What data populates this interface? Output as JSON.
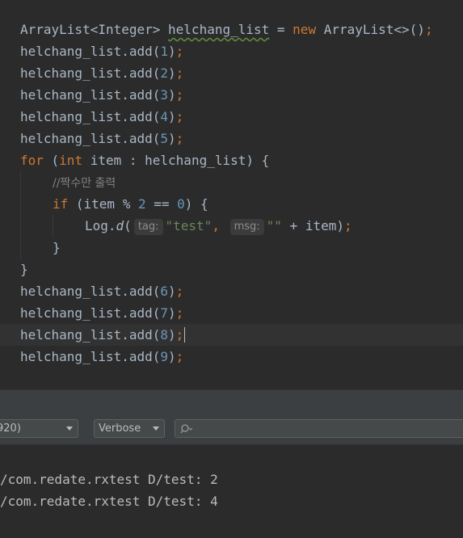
{
  "editor": {
    "line1": {
      "type": "ArrayList<Integer> ",
      "var": "helchang_list",
      "eq": " = ",
      "kw_new": "new",
      "ctor": " ArrayList<>()",
      "semi": ";"
    },
    "adds_top": [
      {
        "prefix": "helchang_list.add(",
        "num": "1",
        "suffix": ")",
        "semi": ";"
      },
      {
        "prefix": "helchang_list.add(",
        "num": "2",
        "suffix": ")",
        "semi": ";"
      },
      {
        "prefix": "helchang_list.add(",
        "num": "3",
        "suffix": ")",
        "semi": ";"
      },
      {
        "prefix": "helchang_list.add(",
        "num": "4",
        "suffix": ")",
        "semi": ";"
      },
      {
        "prefix": "helchang_list.add(",
        "num": "5",
        "suffix": ")",
        "semi": ";"
      }
    ],
    "for_line": {
      "kw_for": "for",
      "open": " (",
      "kw_int": "int",
      "rest": " item : helchang_list) {"
    },
    "comment": "//짝수만 출력",
    "if_line": {
      "kw_if": "if",
      "open": " (item % ",
      "num2": "2",
      "mid": " == ",
      "num0": "0",
      "close": ") {"
    },
    "log_line": {
      "obj": "Log.",
      "method": "d",
      "paren": "(",
      "hint_tag": "tag:",
      "str_test": "\"test\"",
      "comma": ",",
      "hint_msg": "msg:",
      "str_empty": "\"\"",
      "rest": " + item)",
      "semi": ";"
    },
    "close_if": "}",
    "close_for": "}",
    "adds_bottom": [
      {
        "prefix": "helchang_list.add(",
        "num": "6",
        "suffix": ")",
        "semi": ";"
      },
      {
        "prefix": "helchang_list.add(",
        "num": "7",
        "suffix": ")",
        "semi": ";"
      },
      {
        "prefix": "helchang_list.add(",
        "num": "8",
        "suffix": ")",
        "semi": ";"
      },
      {
        "prefix": "helchang_list.add(",
        "num": "9",
        "suffix": ")",
        "semi": ";"
      }
    ]
  },
  "logcat": {
    "process_dropdown": "920)",
    "level_dropdown": "Verbose",
    "search_icon": "search-icon",
    "search_placeholder": "",
    "lines": [
      "/com.redate.rxtest D/test: 2",
      "/com.redate.rxtest D/test: 4"
    ]
  },
  "colors": {
    "keyword": "#cc7832",
    "number": "#6897bb",
    "string": "#6a8759",
    "comment": "#808080",
    "text": "#a9b7c6",
    "background": "#2b2b2b"
  }
}
